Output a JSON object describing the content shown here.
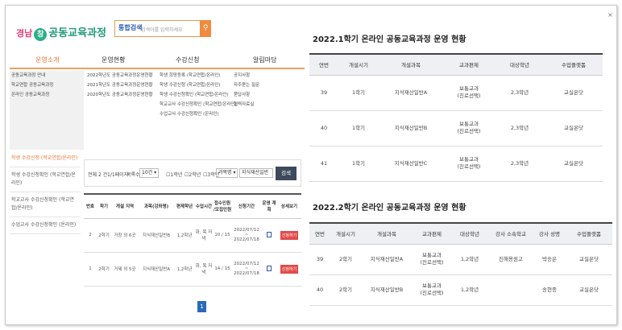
{
  "logo": {
    "prefix": "경남",
    "badge": "창",
    "title": "공동교육과정"
  },
  "search": {
    "tag": "통합검색",
    "placeholder": "검색어를 입력하세요",
    "icon": "search-icon"
  },
  "gnb": [
    "운영소개",
    "운영현황",
    "수강신청",
    "알림마당"
  ],
  "submenu": {
    "col1": [
      "공동교육과정 안내",
      "학교연합 공동교육과정",
      "온라인 공동교육과정"
    ],
    "col2": [
      "2022학년도 공동교육과정운영현황",
      "2021학년도 공동교육과정운영현황",
      "2020학년도 공동교육과정운영현황"
    ],
    "col3": [
      "학생 희망등록 (학교연합/온라인)",
      "학생 수강신청 (학교연합/온라인)",
      "학생 수강신청확인 (학교연합/온라인)",
      "학교교사 수강신청확인 (학교연합/온라인)",
      "수업교사 수강신청확인 (온라인)"
    ],
    "col4": [
      "공지사항",
      "자주묻는 질문",
      "묻답사항",
      "협력자료실"
    ]
  },
  "lnb": [
    "학생 수강신청 (학교연합/온라인)",
    "학생 수강신청확인 (학교연합/온라인)",
    "학교교사 수강신청확인 (학교연합/온라인)",
    "수업교사 수강신청확인 (온라인)"
  ],
  "filter": {
    "total": "전체 2 건",
    "page": "1/1페이지",
    "per_label": "목록수 :",
    "per_value": "10건",
    "grade1": "1학년",
    "grade2": "2학년",
    "grade3": "3학년",
    "subject_sel": "과목명",
    "keyword": "지식재산일반",
    "search_btn": "검색"
  },
  "list_table": {
    "headers": [
      "번호",
      "학기",
      "개설 지역",
      "과목(강좌명)",
      "편제학년",
      "수업시간",
      "접수인원 /모집인원",
      "신청기간",
      "운영 계획",
      "상세보기"
    ],
    "rows": [
      {
        "no": "2",
        "term": "2학기",
        "region": "거창 외 6곳",
        "subject": "지식재산일반B",
        "grade": "1,2학년",
        "time": "화, 목 저녁",
        "count": "10 / 15",
        "period": "2022/07/12 ~ 2022/07/18",
        "apply": "신청하기"
      },
      {
        "no": "1",
        "term": "2학기",
        "region": "거제 외 5곳",
        "subject": "지식재산일반A",
        "grade": "1,2학년",
        "time": "화, 목 저녁",
        "count": "14 / 15",
        "period": "2022/07/12 ~ 2022/07/18",
        "apply": "신청하기"
      }
    ],
    "page": "1"
  },
  "right": {
    "close": "×",
    "title1": "2022.1학기 온라인 공동교육과정 운영 현황",
    "headers1": [
      "연번",
      "개설시기",
      "개설과목",
      "교과편제",
      "대상학년",
      "수업플랫폼"
    ],
    "rows1": [
      [
        "39",
        "1학기",
        "지식재산일반A",
        "보통교과\n(진로선택)",
        "2,3학년",
        "교실온닷"
      ],
      [
        "40",
        "1학기",
        "지식재산일반B",
        "보통교과\n(진로선택)",
        "2,3학년",
        "교실온닷"
      ],
      [
        "41",
        "1학기",
        "지식재산일반C",
        "보통교과\n(진로선택)",
        "2,3학년",
        "교실온닷"
      ]
    ],
    "title2": "2022.2학기 온라인 공동교육과정 운영 현황",
    "headers2": [
      "연번",
      "개설시기",
      "개설과목",
      "교과편제",
      "대상학년",
      "강사 소속학교",
      "강사 성명",
      "수업플랫폼"
    ],
    "rows2": [
      [
        "39",
        "2학기",
        "지식재산일반A",
        "보통교과\n(진로선택)",
        "1,2학년",
        "진해용원고",
        "박승은",
        "교실온닷"
      ],
      [
        "40",
        "2학기",
        "지식재산일반B",
        "보통교과\n(진로선택)",
        "1,2학년",
        "",
        "송현종",
        "교실온닷"
      ]
    ]
  }
}
